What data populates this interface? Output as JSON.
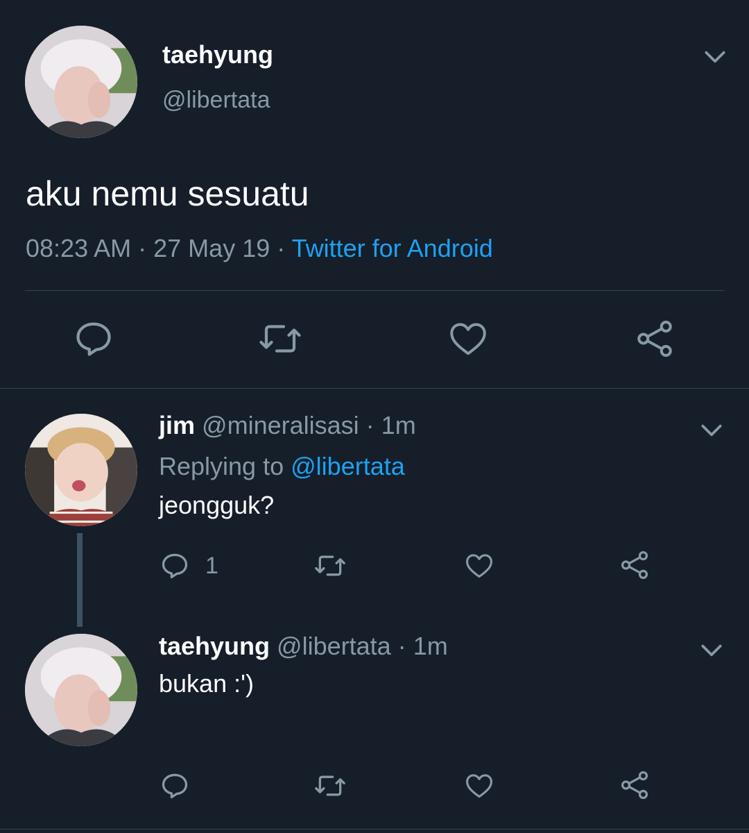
{
  "main_tweet": {
    "display_name": "taehyung",
    "handle": "@libertata",
    "text": "aku nemu sesuatu",
    "time": "08:23 AM",
    "sep1": "·",
    "date": "27 May 19",
    "sep2": "·",
    "source": "Twitter for Android"
  },
  "replies": [
    {
      "display_name": "jim",
      "handle": "@mineralisasi",
      "sep": "·",
      "age": "1m",
      "replying_prefix": "Replying to",
      "replying_handle": "@libertata",
      "text": "jeongguk?",
      "reply_count": "1"
    },
    {
      "display_name": "taehyung",
      "handle": "@libertata",
      "sep": "·",
      "age": "1m",
      "text": "bukan :')"
    }
  ],
  "colors": {
    "background": "#151e29",
    "muted": "#8899a6",
    "link": "#1da1f2",
    "divider": "#38444d"
  },
  "icons": [
    "chevron-down-icon",
    "reply-icon",
    "retweet-icon",
    "like-icon",
    "share-icon"
  ]
}
